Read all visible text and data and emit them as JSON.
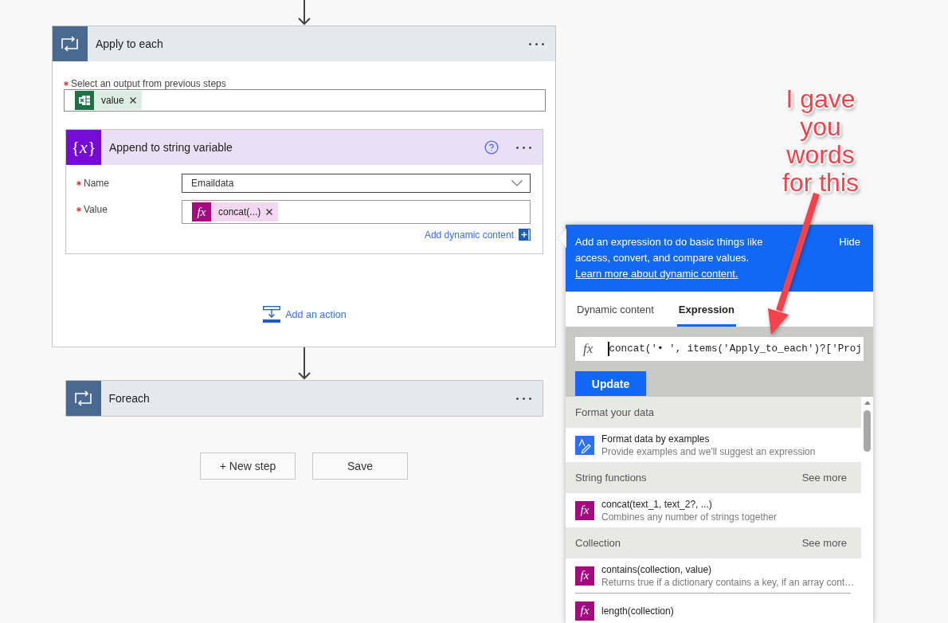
{
  "apply_to_each": {
    "title": "Apply to each",
    "input": {
      "label": "Select an output from previous steps",
      "required": true,
      "tokens": [
        {
          "kind": "excel",
          "label": "value"
        }
      ]
    },
    "action": {
      "title": "Append to string variable",
      "icon_text": "{*x*}",
      "fields": [
        {
          "kind": "dropdown",
          "label": "Name",
          "required": true,
          "value": "Emaildata"
        },
        {
          "kind": "tokens",
          "label": "Value",
          "required": true,
          "tokens": [
            {
              "kind": "expression",
              "icon_text": "fx",
              "label": "concat(...)"
            }
          ]
        }
      ],
      "add_dynamic_content": "Add dynamic content"
    },
    "add_action": "Add an action"
  },
  "foreach": {
    "title": "Foreach"
  },
  "buttons": [
    "+ New step",
    "Save"
  ],
  "expression_panel": {
    "info": "Add an expression to do basic things like access, convert, and compare values.",
    "link": "Learn more about dynamic content.",
    "hide": "Hide",
    "tabs": [
      {
        "label": "Dynamic content",
        "selected": false
      },
      {
        "label": "Expression",
        "selected": true
      }
    ],
    "expression": {
      "icon_text": "fx",
      "value": "concat('• ', items('Apply_to_each')?['Proj",
      "focused": true
    },
    "update": "Update",
    "sections": [
      {
        "title": "Format your data",
        "items": [
          {
            "kind": "example",
            "name": "Format data by examples",
            "description": "Provide examples and we'll suggest an expression"
          }
        ]
      },
      {
        "title": "String functions",
        "see_more": "See more",
        "items": [
          {
            "kind": "function",
            "icon_text": "fx",
            "name": "concat(text_1, text_2?, ...)",
            "description": "Combines any number of strings together"
          }
        ]
      },
      {
        "title": "Collection",
        "see_more": "See more",
        "items": [
          {
            "kind": "function",
            "icon_text": "fx",
            "name": "contains(collection, value)",
            "description": "Returns true if a dictionary contains a key, if an array cont…"
          },
          {
            "kind": "function",
            "icon_text": "fx",
            "name": "length(collection)"
          }
        ]
      }
    ]
  },
  "annotation": {
    "text": "I gave you words for this"
  }
}
